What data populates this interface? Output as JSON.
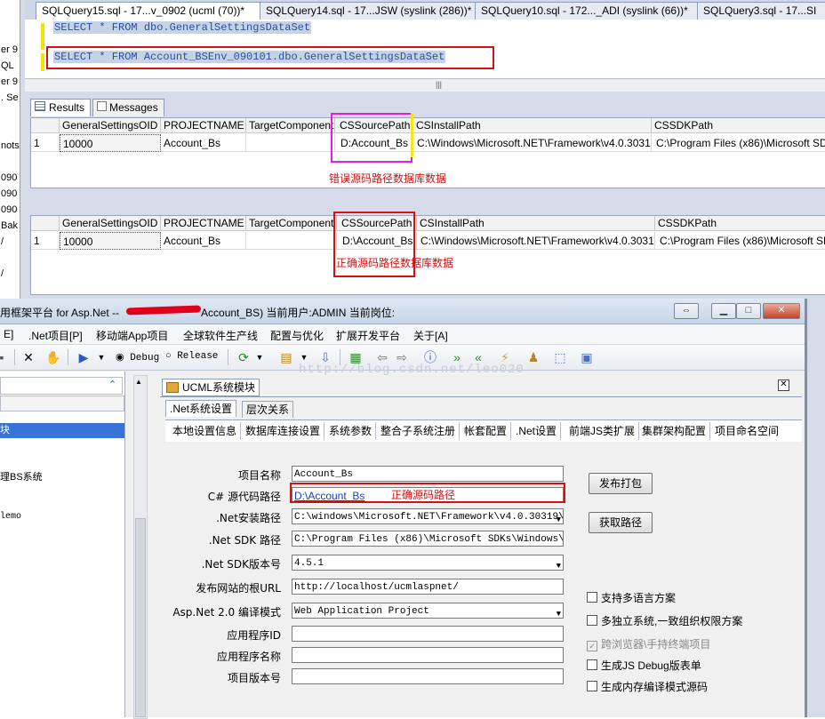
{
  "ssms": {
    "left_strip": [
      "er 9",
      "QL",
      "er 9",
      ". Se",
      "nots",
      "090",
      "090",
      "090",
      "Bak",
      "/",
      "/"
    ],
    "tabs": [
      "SQLQuery15.sql - 17...v_0902 (ucml (70))*",
      "SQLQuery14.sql - 17...JSW (syslink (286))*",
      "SQLQuery10.sql - 172..._ADI (syslink (66))*",
      "SQLQuery3.sql - 17...SI"
    ],
    "query_line1": "SELECT * FROM dbo.GeneralSettingsDataSet",
    "query_line2": "SELECT * FROM Account_BSEnv_090101.dbo.GeneralSettingsDataSet",
    "result_tabs": [
      "Results",
      "Messages"
    ],
    "columns": [
      "GeneralSettingsOID",
      "PROJECTNAME",
      "TargetComponent",
      "CSSourcePath",
      "CSInstallPath",
      "CSSDKPath"
    ],
    "grid1": {
      "row_num": "1",
      "values": [
        "10000",
        "Account_Bs",
        "",
        "D:Account_Bs",
        "C:\\Windows\\Microsoft.NET\\Framework\\v4.0.30319\\",
        "C:\\Program Files (x86)\\Microsoft SDKs\\"
      ]
    },
    "grid1_annotation": "错误源码路径数据库数据",
    "grid2": {
      "row_num": "1",
      "values": [
        "10000",
        "Account_Bs",
        "",
        "D:\\Account_Bs",
        "C:\\Windows\\Microsoft.NET\\Framework\\v4.0.30319\\",
        "C:\\Program Files (x86)\\Microsoft SDKs\\"
      ]
    },
    "grid2_annotation": "正确源码路径数据库数据"
  },
  "app": {
    "title_prefix": "用框架平台 for Asp.Net --",
    "title_suffix": "Account_BS) 当前用户:ADMIN 当前岗位:",
    "menus": [
      "E]",
      ".Net项目[P]",
      "移动端App项目",
      "全球软件生产线",
      "配置与优化",
      "扩展开发平台",
      "关于[A]"
    ],
    "toolbar": {
      "debug_label": "Debug",
      "release_label": "Release"
    },
    "watermark": "http://blog.csdn.net/leo020",
    "left_items": [
      "块",
      "理BS系统",
      "lemo"
    ],
    "doc_tab": "UCML系统模块",
    "primary_tabs": [
      ".Net系统设置",
      "层次关系"
    ],
    "secondary_tabs": [
      "本地设置信息",
      "数据库连接设置",
      "系统参数",
      "整合子系统注册",
      "帐套配置",
      ".Net设置",
      "前端JS类扩展",
      "集群架构配置",
      "项目命名空间"
    ],
    "fields": [
      {
        "label": "项目名称",
        "value": "Account_Bs"
      },
      {
        "label": "C# 源代码路径",
        "value": "D:\\Account_Bs"
      },
      {
        "label": ".Net安装路径",
        "value": "C:\\windows\\Microsoft.NET\\Framework\\v4.0.30319\\"
      },
      {
        "label": ".Net SDK 路径",
        "value": "C:\\Program Files (x86)\\Microsoft SDKs\\Windows\\v8.1a"
      },
      {
        "label": ".Net SDK版本号",
        "value": "4.5.1"
      },
      {
        "label": "发布网站的根URL",
        "value": "http://localhost/ucmlaspnet/"
      },
      {
        "label": "Asp.Net 2.0 编译模式",
        "value": "Web Application Project"
      },
      {
        "label": "应用程序ID",
        "value": ""
      },
      {
        "label": "应用程序名称",
        "value": ""
      },
      {
        "label": "项目版本号",
        "value": ""
      }
    ],
    "source_path_annotation": "正确源码路径",
    "buttons": {
      "publish": "发布打包",
      "get_path": "获取路径"
    },
    "checkboxes": [
      {
        "label": "支持多语言方案",
        "checked": false,
        "disabled": false
      },
      {
        "label": "多独立系统,一致组织权限方案",
        "checked": false,
        "disabled": false
      },
      {
        "label": "跨浏览器\\手持终端项目",
        "checked": true,
        "disabled": true
      },
      {
        "label": "生成JS Debug版表单",
        "checked": false,
        "disabled": false
      },
      {
        "label": "生成内存编译模式源码",
        "checked": false,
        "disabled": false
      }
    ]
  },
  "colors": {
    "annotation_red": "#d21212",
    "highlight_magenta": "#e21ee6",
    "highlight_yellow": "#f3e81a",
    "link_blue": "#1c38c4"
  }
}
